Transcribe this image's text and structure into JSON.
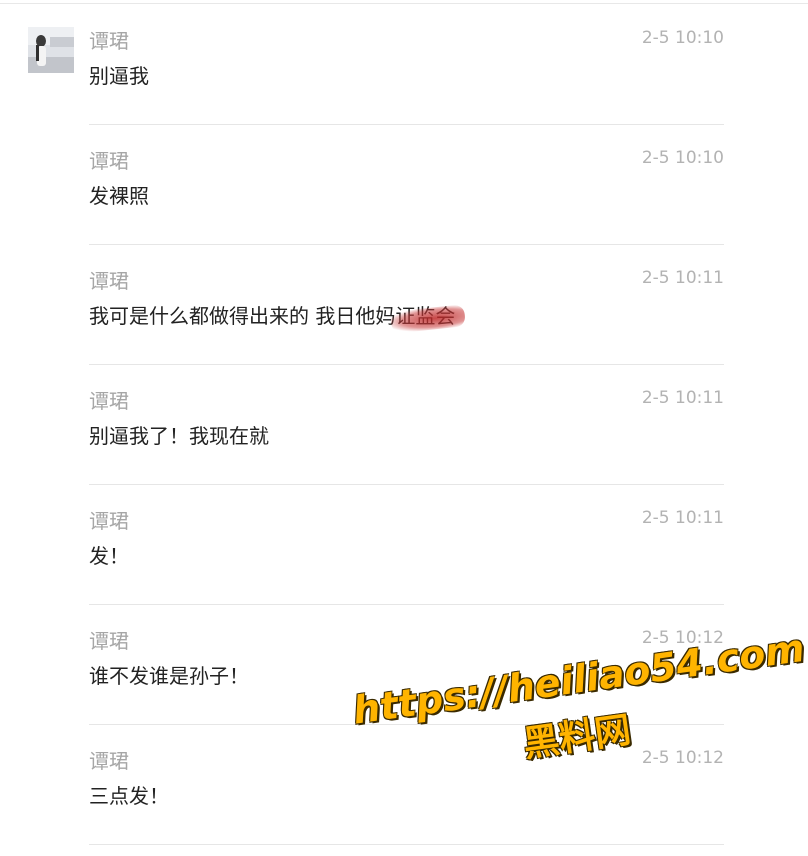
{
  "messages": [
    {
      "sender": "谭珺",
      "time": "2-5 10:10",
      "text": "别逼我"
    },
    {
      "sender": "谭珺",
      "time": "2-5 10:10",
      "text": "发裸照"
    },
    {
      "sender": "谭珺",
      "time": "2-5 10:11",
      "text": "我可是什么都做得出来的 我日他妈",
      "redacted_text": "证监会"
    },
    {
      "sender": "谭珺",
      "time": "2-5 10:11",
      "text": "别逼我了！我现在就"
    },
    {
      "sender": "谭珺",
      "time": "2-5 10:11",
      "text": "发！"
    },
    {
      "sender": "谭珺",
      "time": "2-5 10:12",
      "text": "谁不发谁是孙子！"
    },
    {
      "sender": "谭珺",
      "time": "2-5 10:12",
      "text": "三点发！"
    }
  ],
  "watermark": {
    "url": "https://heiliao54.com",
    "name": "黑料网"
  },
  "colors": {
    "sender": "#a6a6a6",
    "time": "#b3b3b3",
    "text": "#222222",
    "separator": "#e6e6e6",
    "watermark": "#ffb400"
  }
}
